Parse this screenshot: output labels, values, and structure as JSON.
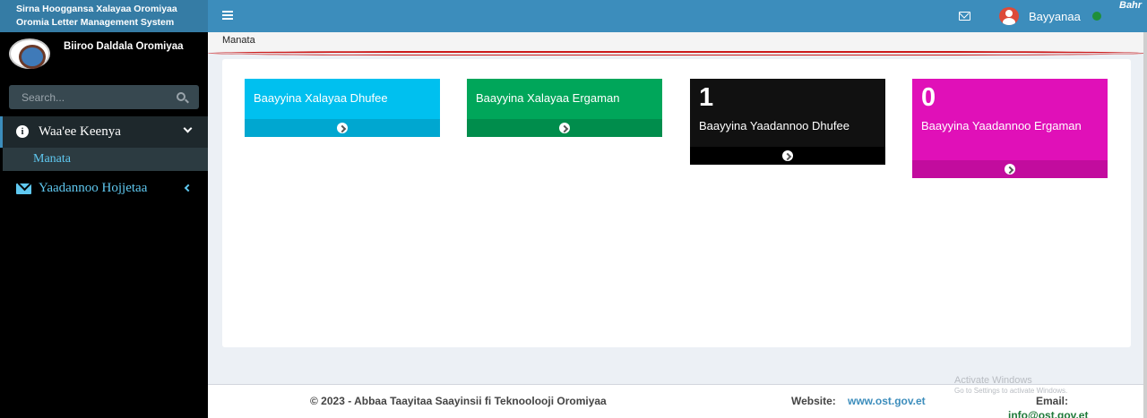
{
  "brand": {
    "line1": "Sirna Hooggansa Xalayaa Oromiyaa",
    "line2": "Oromia Letter Management System"
  },
  "header": {
    "user_name": "Bayyanaa",
    "corner_text": "Bahr"
  },
  "sidebar": {
    "org_name": "Biiroo Daldala Oromiyaa",
    "search_placeholder": "Search...",
    "menu": [
      {
        "label": "Waa'ee Keenya",
        "icon": "info-icon",
        "expanded": true
      },
      {
        "label": "Manata",
        "active": true
      },
      {
        "label": "Yaadannoo Hojjetaa",
        "icon": "envelope-icon",
        "expanded": false
      }
    ]
  },
  "breadcrumb": "Manata",
  "tiles": [
    {
      "title": "Baayyina Xalayaa Dhufee",
      "count": "",
      "color": "#00c0ef"
    },
    {
      "title": "Baayyina Xalayaa Ergaman",
      "count": "",
      "color": "#00a65a"
    },
    {
      "title": "Baayyina Yaadannoo Dhufee",
      "count": "1",
      "color": "#111111"
    },
    {
      "title": "Baayyina Yaadannoo Ergaman",
      "count": "0",
      "color": "#e010b8"
    }
  ],
  "footer": {
    "copyright": "© 2023 - Abbaa Taayitaa Saayinsii fi Teknoolooji Oromiyaa",
    "website_label": "Website:",
    "website": "www.ost.gov.et",
    "email_label": "Email:",
    "email": "info@ost.gov.et"
  },
  "watermark": {
    "title": "Activate Windows",
    "subtitle": "Go to Settings to activate Windows."
  }
}
